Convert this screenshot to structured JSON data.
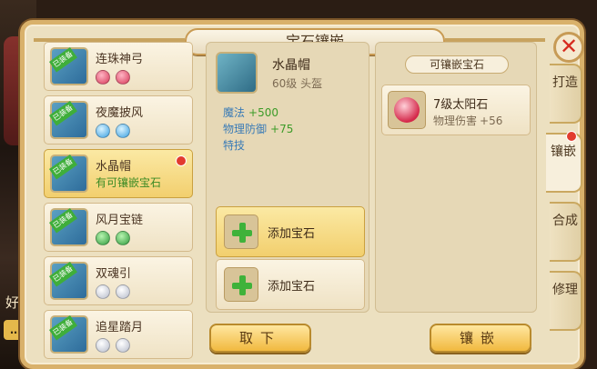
{
  "window": {
    "title": "宝石镶嵌",
    "close_symbol": "✕"
  },
  "background": {
    "side_text": "好友",
    "chat_icon_text": "…"
  },
  "equipment_list": [
    {
      "name": "连珠神弓",
      "badge": "已装备",
      "gems": [
        "red",
        "red"
      ],
      "selected": false
    },
    {
      "name": "夜魔披风",
      "badge": "已装备",
      "gems": [
        "blue",
        "blue"
      ],
      "selected": false
    },
    {
      "name": "水晶帽",
      "badge": "已装备",
      "sub": "有可镶嵌宝石",
      "selected": true,
      "notify": true
    },
    {
      "name": "风月宝链",
      "badge": "已装备",
      "gems": [
        "green",
        "green"
      ],
      "selected": false
    },
    {
      "name": "双魂引",
      "badge": "已装备",
      "gems": [
        "white",
        "white"
      ],
      "selected": false
    },
    {
      "name": "追星踏月",
      "badge": "已装备",
      "gems": [
        "white",
        "white"
      ],
      "selected": false
    }
  ],
  "detail": {
    "name": "水晶帽",
    "level_type": "60级 头盔",
    "stats": [
      {
        "key": "魔法",
        "value": "+500"
      },
      {
        "key": "物理防御",
        "value": "+75"
      }
    ],
    "special": "特技",
    "slots": [
      {
        "label": "添加宝石",
        "active": true
      },
      {
        "label": "添加宝石",
        "active": false
      }
    ]
  },
  "gem_panel": {
    "title": "可镶嵌宝石",
    "gems": [
      {
        "name": "7级太阳石",
        "stat_key": "物理伤害",
        "stat_value": "+56"
      }
    ]
  },
  "side_tabs": [
    {
      "label": "打造",
      "active": false
    },
    {
      "label": "镶嵌",
      "active": true,
      "notify": true
    },
    {
      "label": "合成",
      "active": false
    },
    {
      "label": "修理",
      "active": false
    }
  ],
  "buttons": {
    "remove": "取下",
    "inlay": "镶嵌"
  },
  "colors": {
    "frame": "#d9b16b",
    "panel_bg": "#ece0c0",
    "selected": "#f2cf6e",
    "stat_value": "#3c9b28",
    "stat_key": "#3a7bb6",
    "notify": "#e23b2e"
  }
}
